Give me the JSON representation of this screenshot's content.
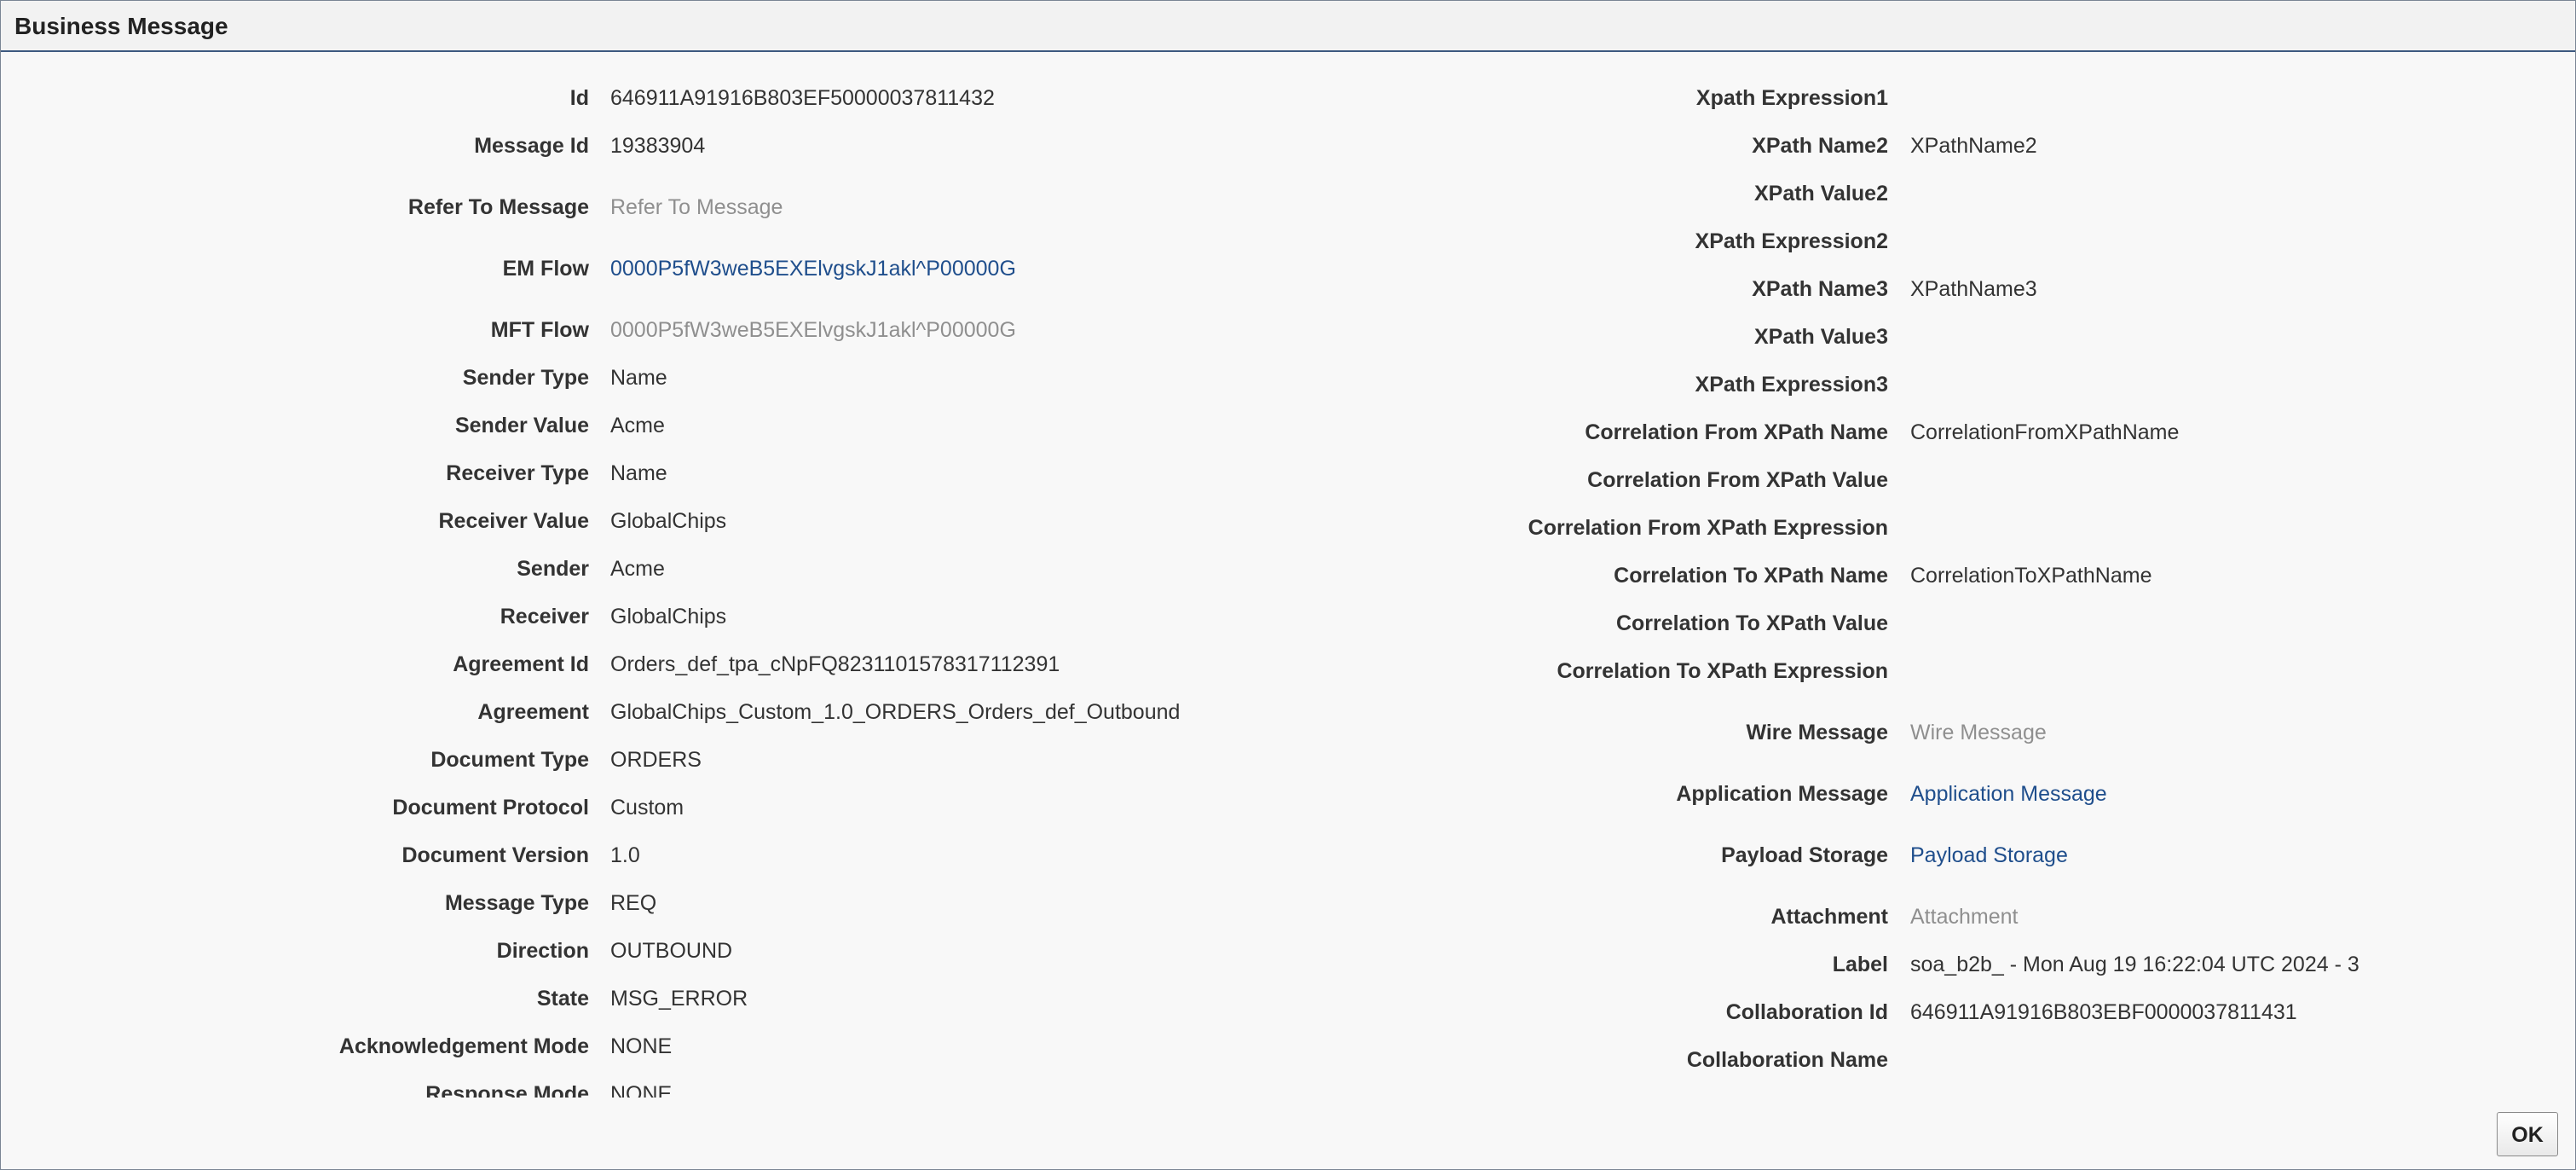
{
  "dialog": {
    "title": "Business Message",
    "ok_label": "OK"
  },
  "left_fields": [
    {
      "label": "Id",
      "value": "646911A91916B803EF50000037811432",
      "style": "text"
    },
    {
      "label": "Message Id",
      "value": "19383904",
      "style": "text"
    },
    {
      "label": "Refer To Message",
      "value": "Refer To Message",
      "style": "disabled"
    },
    {
      "label": "EM Flow",
      "value": "0000P5fW3weB5EXElvgskJ1akl^P00000G",
      "style": "link"
    },
    {
      "label": "MFT Flow",
      "value": "0000P5fW3weB5EXElvgskJ1akl^P00000G",
      "style": "disabled"
    },
    {
      "label": "Sender Type",
      "value": "Name",
      "style": "text"
    },
    {
      "label": "Sender Value",
      "value": "Acme",
      "style": "text"
    },
    {
      "label": "Receiver Type",
      "value": "Name",
      "style": "text"
    },
    {
      "label": "Receiver Value",
      "value": "GlobalChips",
      "style": "text"
    },
    {
      "label": "Sender",
      "value": "Acme",
      "style": "text"
    },
    {
      "label": "Receiver",
      "value": "GlobalChips",
      "style": "text"
    },
    {
      "label": "Agreement Id",
      "value": "Orders_def_tpa_cNpFQ8231101578317112391",
      "style": "text"
    },
    {
      "label": "Agreement",
      "value": "GlobalChips_Custom_1.0_ORDERS_Orders_def_Outbound",
      "style": "text"
    },
    {
      "label": "Document Type",
      "value": "ORDERS",
      "style": "text"
    },
    {
      "label": "Document Protocol",
      "value": "Custom",
      "style": "text"
    },
    {
      "label": "Document Version",
      "value": "1.0",
      "style": "text"
    },
    {
      "label": "Message Type",
      "value": "REQ",
      "style": "text"
    },
    {
      "label": "Direction",
      "value": "OUTBOUND",
      "style": "text"
    },
    {
      "label": "State",
      "value": "MSG_ERROR",
      "style": "text"
    },
    {
      "label": "Acknowledgement Mode",
      "value": "NONE",
      "style": "text"
    },
    {
      "label": "Response Mode",
      "value": "NONE",
      "style": "text"
    }
  ],
  "right_fields": [
    {
      "label": "Xpath Expression1",
      "value": "",
      "style": "text"
    },
    {
      "label": "XPath Name2",
      "value": "XPathName2",
      "style": "text"
    },
    {
      "label": "XPath Value2",
      "value": "",
      "style": "text"
    },
    {
      "label": "XPath Expression2",
      "value": "",
      "style": "text"
    },
    {
      "label": "XPath Name3",
      "value": "XPathName3",
      "style": "text"
    },
    {
      "label": "XPath Value3",
      "value": "",
      "style": "text"
    },
    {
      "label": "XPath Expression3",
      "value": "",
      "style": "text"
    },
    {
      "label": "Correlation From XPath Name",
      "value": "CorrelationFromXPathName",
      "style": "text"
    },
    {
      "label": "Correlation From XPath Value",
      "value": "",
      "style": "text"
    },
    {
      "label": "Correlation From XPath Expression",
      "value": "",
      "style": "text"
    },
    {
      "label": "Correlation To XPath Name",
      "value": "CorrelationToXPathName",
      "style": "text"
    },
    {
      "label": "Correlation To XPath Value",
      "value": "",
      "style": "text"
    },
    {
      "label": "Correlation To XPath Expression",
      "value": "",
      "style": "text"
    },
    {
      "label": "Wire Message",
      "value": "Wire Message",
      "style": "disabled"
    },
    {
      "label": "Application Message",
      "value": "Application Message",
      "style": "link"
    },
    {
      "label": "Payload Storage",
      "value": "Payload Storage",
      "style": "link"
    },
    {
      "label": "Attachment",
      "value": "Attachment",
      "style": "disabled"
    },
    {
      "label": "Label",
      "value": "soa_b2b_ - Mon Aug 19 16:22:04 UTC 2024 - 3",
      "style": "text"
    },
    {
      "label": "Collaboration Id",
      "value": "646911A91916B803EBF0000037811431",
      "style": "text"
    },
    {
      "label": "Collaboration Name",
      "value": "",
      "style": "text"
    }
  ]
}
